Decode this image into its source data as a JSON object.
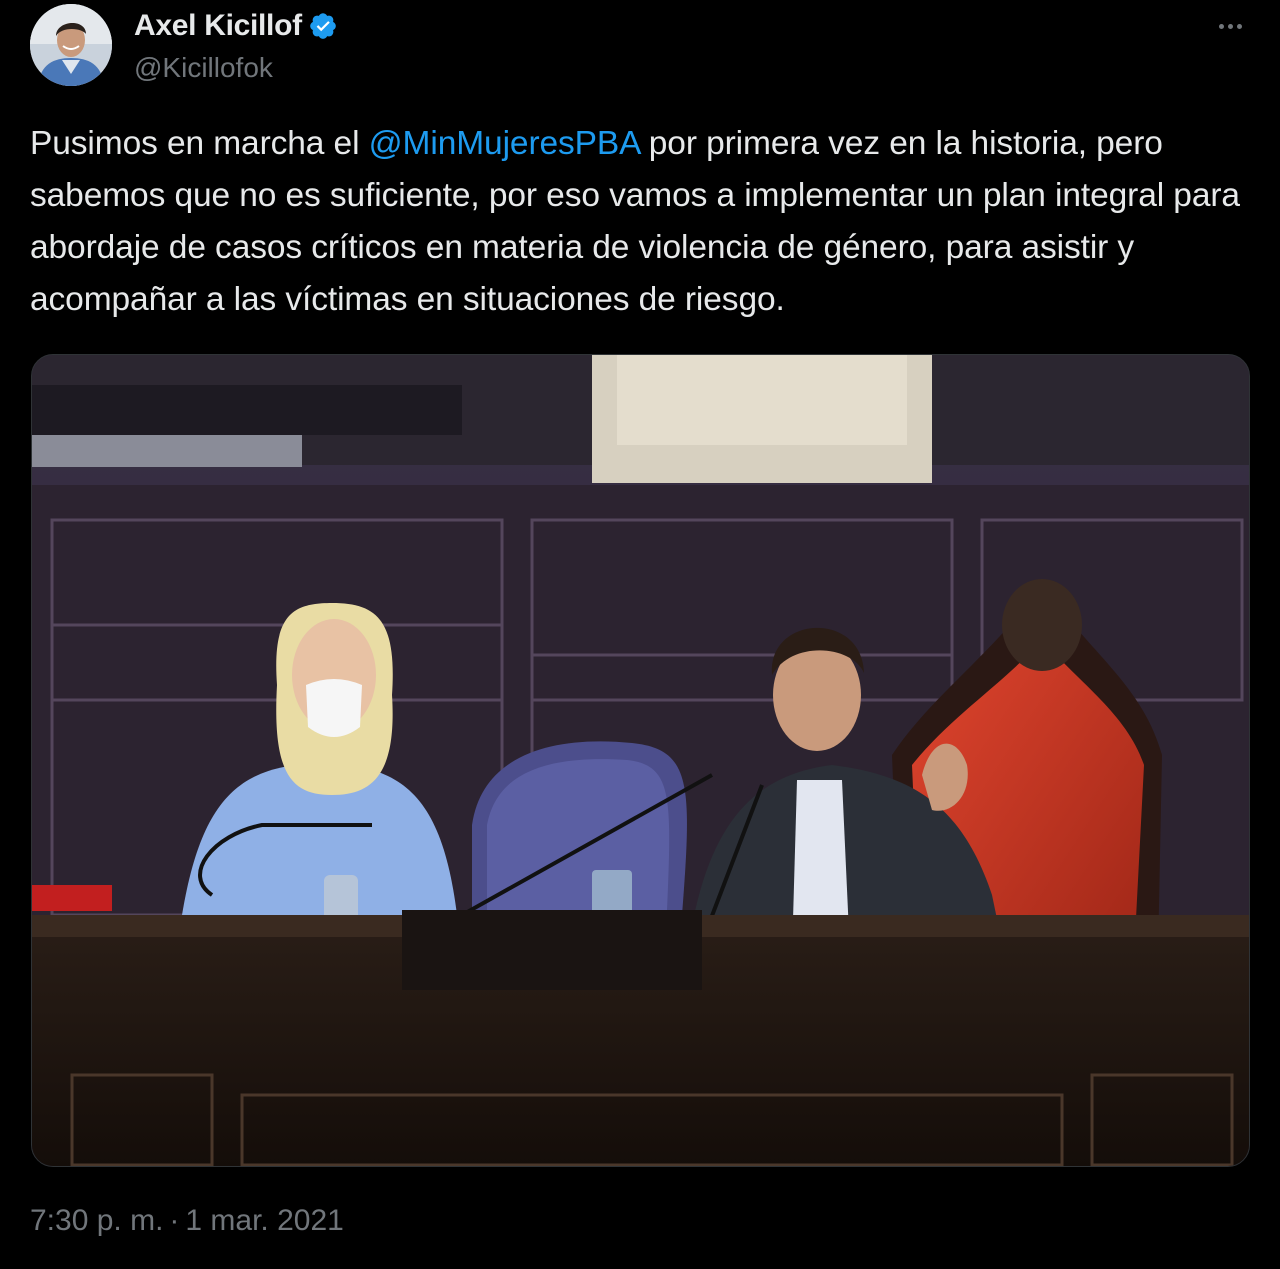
{
  "tweet": {
    "author": {
      "display_name": "Axel Kicillof",
      "handle": "@Kicillofok",
      "verified": true
    },
    "text_before": "Pusimos en marcha el ",
    "mention": "@MinMujeresPBA",
    "text_after": " por primera vez en la historia, pero sabemos que no es suficiente, por eso vamos a implementar un plan integral para abordaje de casos críticos en materia de violencia de género, para asistir y acompañar a las víctimas en situaciones de riesgo.",
    "time": "7:30 p. m.",
    "separator": "·",
    "date": "1 mar. 2021"
  },
  "icons": {
    "verified": "verified-badge-icon",
    "more": "more-horizontal-icon"
  },
  "colors": {
    "background": "#000000",
    "text": "#e7e9ea",
    "secondary": "#71767b",
    "accent": "#1d9bf0"
  }
}
